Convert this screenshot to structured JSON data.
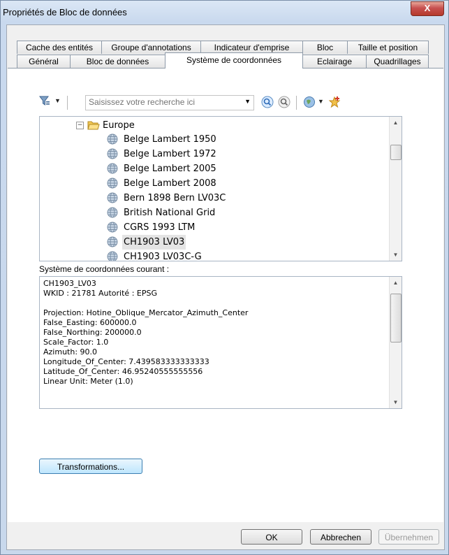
{
  "window": {
    "title": "Propriétés de Bloc de données",
    "close_label": "X"
  },
  "tabs_row1": [
    "Cache des entités",
    "Groupe d'annotations",
    "Indicateur d'emprise",
    "Bloc",
    "Taille et position"
  ],
  "tabs_row2": [
    "Général",
    "Bloc de données",
    "Système de coordonnées",
    "Eclairage",
    "Quadrillages"
  ],
  "active_tab": "Système de coordonnées",
  "search": {
    "placeholder": "Saisissez votre recherche ici"
  },
  "tree": {
    "folder": "Europe",
    "items": [
      "Belge Lambert 1950",
      "Belge Lambert 1972",
      "Belge Lambert 2005",
      "Belge Lambert 2008",
      "Bern 1898 Bern LV03C",
      "British National Grid",
      "CGRS 1993 LTM",
      "CH1903 LV03",
      "CH1903 LV03C-G"
    ],
    "selected_item": "CH1903 LV03"
  },
  "current_cs": {
    "label": "Système de coordonnées courant :",
    "lines": [
      "CH1903_LV03",
      "WKID : 21781 Autorité : EPSG",
      "",
      "Projection: Hotine_Oblique_Mercator_Azimuth_Center",
      "False_Easting: 600000.0",
      "False_Northing: 200000.0",
      "Scale_Factor: 1.0",
      "Azimuth: 90.0",
      "Longitude_Of_Center: 7.439583333333333",
      "Latitude_Of_Center: 46.95240555555556",
      "Linear Unit: Meter (1.0)"
    ]
  },
  "buttons": {
    "transformations": "Transformations...",
    "ok": "OK",
    "cancel": "Abbrechen",
    "apply": "Übernehmen"
  },
  "colors": {
    "accent_blue": "#3c7fb1",
    "close_red": "#c75050",
    "folder_yellow": "#f3c955",
    "globe_blue": "#8aa9c8"
  }
}
